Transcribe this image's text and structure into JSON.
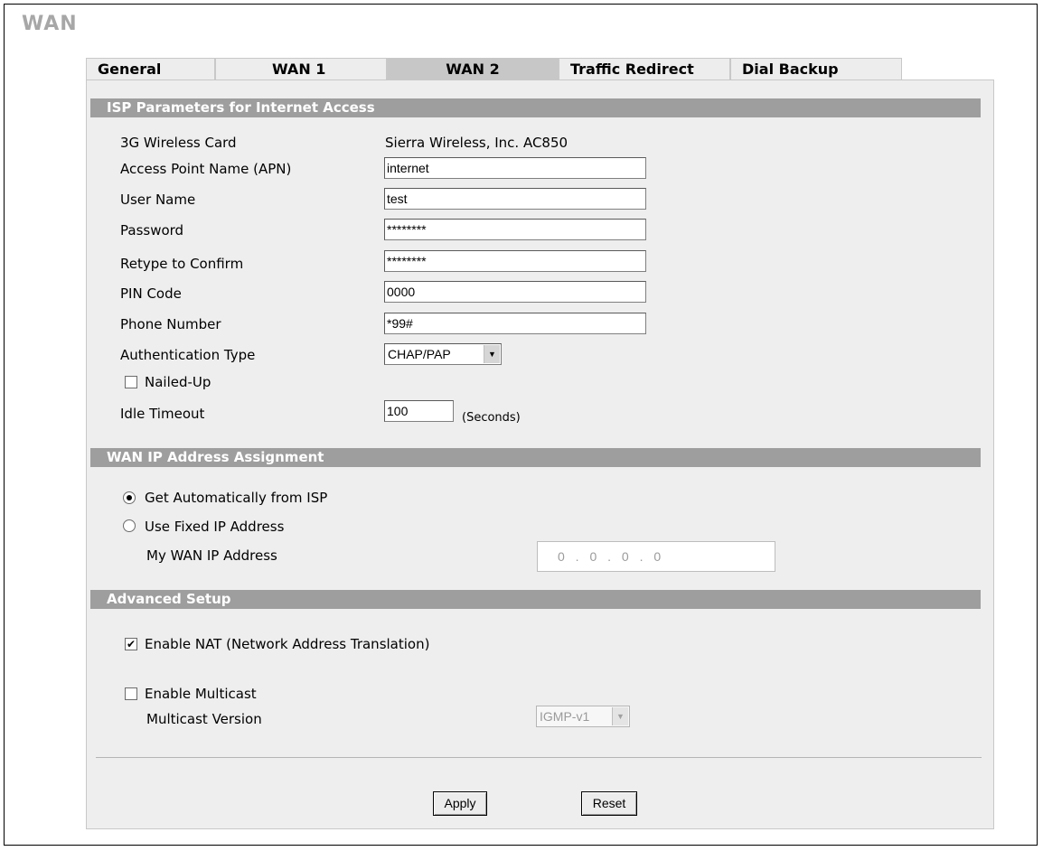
{
  "page": {
    "title": "WAN"
  },
  "tabs": [
    {
      "label": "General",
      "active": false
    },
    {
      "label": "WAN 1",
      "active": false
    },
    {
      "label": "WAN 2",
      "active": true
    },
    {
      "label": "Traffic Redirect",
      "active": false
    },
    {
      "label": "Dial Backup",
      "active": false
    }
  ],
  "isp": {
    "header": "ISP Parameters for Internet Access",
    "card_label": "3G Wireless Card",
    "card_value": "Sierra Wireless, Inc. AC850",
    "apn_label": "Access Point Name (APN)",
    "apn_value": "internet",
    "username_label": "User Name",
    "username_value": "test",
    "password_label": "Password",
    "password_value": "********",
    "retype_label": "Retype to Confirm",
    "retype_value": "********",
    "pin_label": "PIN Code",
    "pin_value": "0000",
    "phone_label": "Phone Number",
    "phone_value": "*99#",
    "auth_label": "Authentication Type",
    "auth_value": "CHAP/PAP",
    "nailed_label": "Nailed-Up",
    "nailed_checked": false,
    "idle_label": "Idle Timeout",
    "idle_value": "100",
    "idle_unit": "(Seconds)"
  },
  "wanip": {
    "header": "WAN IP Address Assignment",
    "auto_label": "Get Automatically from ISP",
    "auto_selected": true,
    "fixed_label": "Use Fixed IP Address",
    "fixed_selected": false,
    "ip_label": "My WAN IP Address",
    "ip_value": "0 . 0 . 0 . 0"
  },
  "advanced": {
    "header": "Advanced Setup",
    "nat_label": "Enable NAT (Network Address Translation)",
    "nat_checked": true,
    "multicast_label": "Enable Multicast",
    "multicast_checked": false,
    "version_label": "Multicast Version",
    "version_value": "IGMP-v1"
  },
  "buttons": {
    "apply": "Apply",
    "reset": "Reset"
  },
  "icons": {
    "dropdown": "dropdown-arrow-icon",
    "check": "checkmark-icon"
  },
  "colors": {
    "section_bar": "#9e9e9e",
    "panel": "#eeeeee",
    "title": "#a7a7a7",
    "active_tab": "#c7c7c7"
  }
}
